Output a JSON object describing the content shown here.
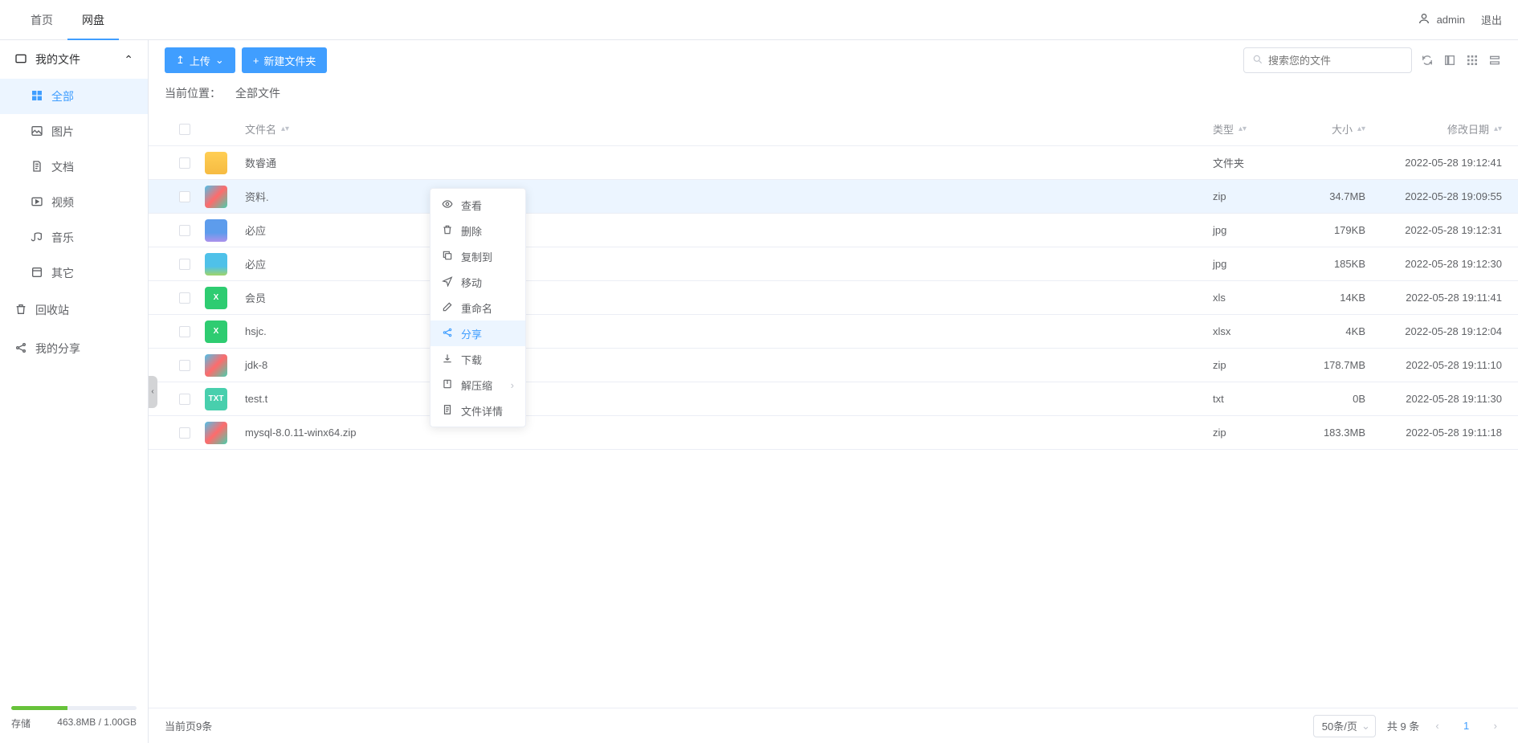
{
  "header": {
    "tabs": [
      {
        "label": "首页",
        "active": false
      },
      {
        "label": "网盘",
        "active": true
      }
    ],
    "username": "admin",
    "logout_label": "退出"
  },
  "sidebar": {
    "my_files_label": "我的文件",
    "categories": [
      {
        "label": "全部",
        "icon": "grid-icon",
        "active": true
      },
      {
        "label": "图片",
        "icon": "image-icon",
        "active": false
      },
      {
        "label": "文档",
        "icon": "document-icon",
        "active": false
      },
      {
        "label": "视频",
        "icon": "video-icon",
        "active": false
      },
      {
        "label": "音乐",
        "icon": "music-icon",
        "active": false
      },
      {
        "label": "其它",
        "icon": "other-icon",
        "active": false
      }
    ],
    "recycle_label": "回收站",
    "share_label": "我的分享",
    "storage": {
      "label": "存储",
      "used_text": "463.8MB / 1.00GB",
      "percent": 45
    }
  },
  "toolbar": {
    "upload_label": "上传",
    "newfolder_label": "新建文件夹",
    "search_placeholder": "搜索您的文件"
  },
  "breadcrumb": {
    "label": "当前位置：",
    "path": "全部文件"
  },
  "table": {
    "columns": {
      "name": "文件名",
      "type": "类型",
      "size": "大小",
      "date": "修改日期"
    },
    "rows": [
      {
        "name": "数睿通",
        "type": "文件夹",
        "size": "",
        "date": "2022-05-28 19:12:41",
        "icon": "folder",
        "selected": false
      },
      {
        "name": "资料.",
        "type": "zip",
        "size": "34.7MB",
        "date": "2022-05-28 19:09:55",
        "icon": "zip",
        "selected": true
      },
      {
        "name": "必应",
        "type": "jpg",
        "size": "179KB",
        "date": "2022-05-28 19:12:31",
        "icon": "img1",
        "selected": false
      },
      {
        "name": "必应",
        "type": "jpg",
        "size": "185KB",
        "date": "2022-05-28 19:12:30",
        "icon": "img2",
        "selected": false
      },
      {
        "name": "会员",
        "type": "xls",
        "size": "14KB",
        "date": "2022-05-28 19:11:41",
        "icon": "xls",
        "selected": false
      },
      {
        "name": "hsjc.",
        "type": "xlsx",
        "size": "4KB",
        "date": "2022-05-28 19:12:04",
        "icon": "xls",
        "selected": false
      },
      {
        "name": "jdk-8",
        "type": "zip",
        "size": "178.7MB",
        "date": "2022-05-28 19:11:10",
        "icon": "zip",
        "selected": false
      },
      {
        "name": "test.t",
        "type": "txt",
        "size": "0B",
        "date": "2022-05-28 19:11:30",
        "icon": "txt",
        "selected": false
      },
      {
        "name": "mysql-8.0.11-winx64.zip",
        "type": "zip",
        "size": "183.3MB",
        "date": "2022-05-28 19:11:18",
        "icon": "zip",
        "selected": false
      }
    ]
  },
  "context_menu": {
    "items": [
      {
        "label": "查看",
        "icon": "eye-icon"
      },
      {
        "label": "删除",
        "icon": "trash-icon"
      },
      {
        "label": "复制到",
        "icon": "copy-icon"
      },
      {
        "label": "移动",
        "icon": "move-icon"
      },
      {
        "label": "重命名",
        "icon": "rename-icon"
      },
      {
        "label": "分享",
        "icon": "share-icon",
        "hover": true
      },
      {
        "label": "下载",
        "icon": "download-icon"
      },
      {
        "label": "解压缩",
        "icon": "extract-icon",
        "has_sub": true
      },
      {
        "label": "文件详情",
        "icon": "detail-icon"
      }
    ]
  },
  "footer": {
    "page_info": "当前页9条",
    "page_size_label": "50条/页",
    "total_label": "共 9 条",
    "current_page": "1"
  }
}
